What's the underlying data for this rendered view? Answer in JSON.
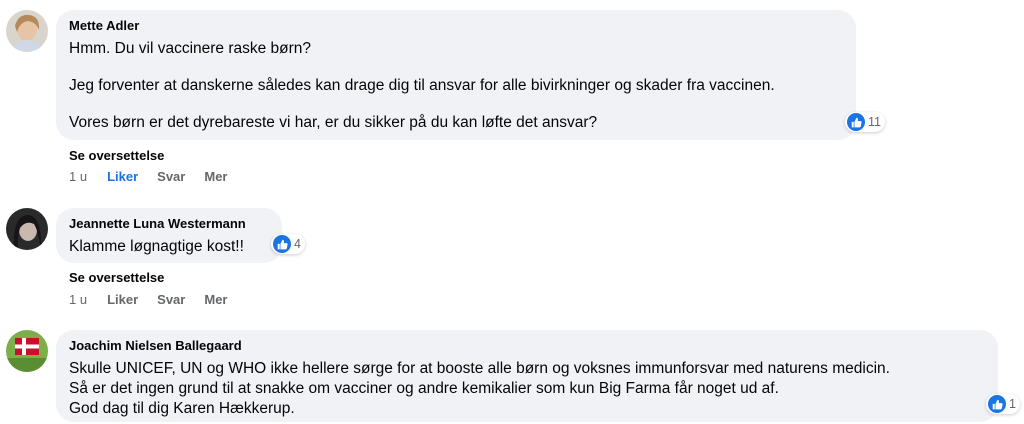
{
  "comments": [
    {
      "author": "Mette Adler",
      "lines": [
        "Hmm. Du vil vaccinere raske børn?",
        "Jeg forventer at danskerne således kan drage dig til ansvar for alle bivirkninger og skader fra vaccinen.",
        "Vores børn er det dyrebareste vi har, er du sikker på du kan løfte det ansvar?"
      ],
      "reaction_count": "11",
      "translate_label": "Se oversettelse",
      "time": "1 u",
      "like_label": "Liker",
      "reply_label": "Svar",
      "more_label": "Mer"
    },
    {
      "author": "Jeannette Luna Westermann",
      "lines": [
        "Klamme løgnagtige kost!!"
      ],
      "reaction_count": "4",
      "translate_label": "Se oversettelse",
      "time": "1 u",
      "like_label": "Liker",
      "reply_label": "Svar",
      "more_label": "Mer"
    },
    {
      "author": "Joachim Nielsen Ballegaard",
      "lines": [
        "Skulle UNICEF, UN og WHO ikke hellere sørge for at booste alle børn og voksnes immunforsvar med naturens medicin.",
        "Så er det ingen grund til at snakke om vacciner og andre kemikalier som kun Big Farma får noget ud af.",
        "God dag til dig Karen Hække rup."
      ],
      "reaction_count": "1"
    }
  ],
  "colors": {
    "bubble": "#f0f2f5",
    "link_blue": "#1b74e4",
    "secondary_text": "#65676b"
  },
  "icons": {
    "reaction": "like-thumb-icon"
  }
}
